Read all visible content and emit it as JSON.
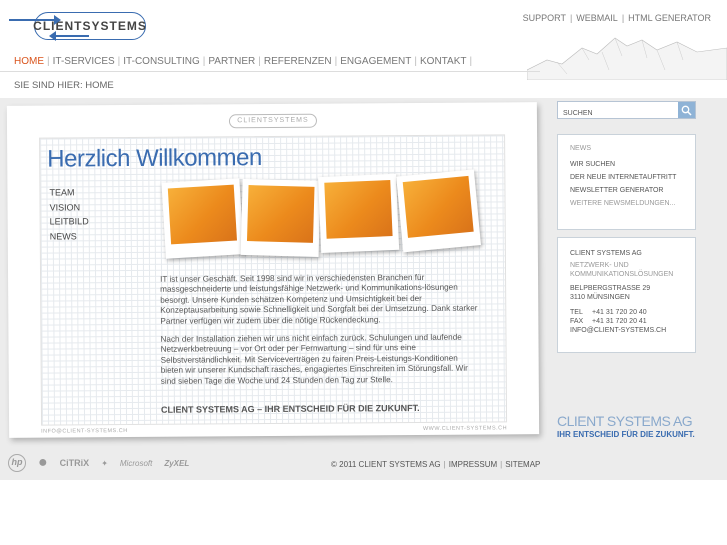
{
  "header": {
    "logo_text": "CLIENTSYSTEMS",
    "toplinks": [
      "SUPPORT",
      "WEBMAIL",
      "HTML GENERATOR"
    ]
  },
  "nav": {
    "items": [
      "HOME",
      "IT-SERVICES",
      "IT-CONSULTING",
      "PARTNER",
      "REFERENZEN",
      "ENGAGEMENT",
      "KONTAKT"
    ],
    "active": "HOME"
  },
  "breadcrumb": "SIE SIND HIER: HOME",
  "main": {
    "paper_logo": "CLIENTSYSTEMS",
    "title": "Herzlich Willkommen",
    "leftnav": [
      "TEAM",
      "VISION",
      "LEITBILD",
      "NEWS"
    ],
    "paragraphs": [
      "IT ist unser Geschäft. Seit 1998 sind wir in verschiedensten Branchen für massgeschneiderte und leistungsfähige Netzwerk- und Kommunikations-lösungen besorgt. Unsere Kunden schätzen Kompetenz und Umsichtigkeit bei der Konzeptausarbeitung sowie Schnelligkeit und Sorgfalt bei der Umsetzung. Dank starker Partner verfügen wir zudem über die nötige Rückendeckung.",
      "Nach der Installation ziehen wir uns nicht einfach zurück. Schulungen und laufende Netzwerkbetreuung – vor Ort oder per Fernwartung – sind für uns eine Selbstverständlichkeit. Mit Serviceverträgen zu fairen Preis-Leistungs-Konditionen bieten wir unserer Kundschaft rasches, engagiertes Einschreiten im Störungsfall. Wir sind sieben Tage die Woche und 24 Stunden den Tag zur Stelle."
    ],
    "tagline": "CLIENT SYSTEMS AG – IHR ENTSCHEID FÜR DIE ZUKUNFT.",
    "paper_email": "INFO@CLIENT-SYSTEMS.CH",
    "paper_url": "WWW.CLIENT-SYSTEMS.CH"
  },
  "search": {
    "placeholder": "SUCHEN",
    "icon": "search-icon"
  },
  "news": {
    "heading": "NEWS",
    "items": [
      "WIR SUCHEN",
      "DER NEUE INTERNETAUFTRITT",
      "NEWSLETTER GENERATOR"
    ],
    "more": "WEITERE NEWSMELDUNGEN..."
  },
  "contact": {
    "company": "CLIENT SYSTEMS AG",
    "subtitle": "NETZWERK- UND KOMMUNIKATIONSLÖSUNGEN",
    "street": "BELPBERGSTRASSE 29",
    "city": "3110 MÜNSINGEN",
    "tel_label": "TEL",
    "tel": "+41 31 720 20 40",
    "fax_label": "FAX",
    "fax": "+41 31 720 20 41",
    "email": "INFO@CLIENT-SYSTEMS.CH"
  },
  "brand": {
    "name": "CLIENT SYSTEMS AG",
    "claim": "IHR ENTSCHEID FÜR DIE ZUKUNFT."
  },
  "partners": {
    "hp": "hp",
    "citrix": "CiTRiX",
    "microsoft": "Microsoft",
    "zyxel": "ZyXEL"
  },
  "footer": {
    "copyright": "© 2011 CLIENT SYSTEMS AG",
    "impressum": "IMPRESSUM",
    "sitemap": "SITEMAP"
  },
  "colors": {
    "accent": "#3a6cb0",
    "active_nav": "#d9541c",
    "photo_orange": "#ec8a1c"
  }
}
